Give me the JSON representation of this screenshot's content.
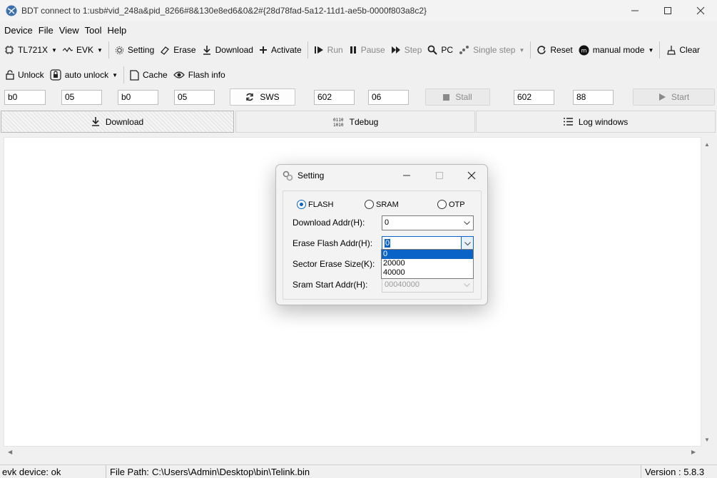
{
  "window": {
    "title": "BDT connect to 1:usb#vid_248a&pid_8266#8&130e8ed6&0&2#{28d78fad-5a12-11d1-ae5b-0000f803a8c2}"
  },
  "menu": [
    "Device",
    "File",
    "View",
    "Tool",
    "Help"
  ],
  "toolbar1": {
    "chip": "TL721X",
    "board": "EVK",
    "setting": "Setting",
    "erase": "Erase",
    "download": "Download",
    "activate": "Activate",
    "run": "Run",
    "pause": "Pause",
    "step": "Step",
    "pc": "PC",
    "single_step": "Single step",
    "reset": "Reset",
    "mode": "manual mode",
    "clear": "Clear"
  },
  "toolbar2": {
    "unlock": "Unlock",
    "auto_unlock": "auto unlock",
    "cache": "Cache",
    "flash_info": "Flash info"
  },
  "registers": {
    "f1": "b0",
    "f2": "05",
    "f3": "b0",
    "f4": "05",
    "sws": "SWS",
    "f5": "602",
    "f6": "06",
    "stall": "Stall",
    "f7": "602",
    "f8": "88",
    "start": "Start"
  },
  "tabs": {
    "download": "Download",
    "tdebug": "Tdebug",
    "log": "Log windows"
  },
  "status": {
    "device": "evk device: ok",
    "file_path_label": "File Path:",
    "file_path": "C:\\Users\\Admin\\Desktop\\bin\\Telink.bin",
    "version": "Version : 5.8.3"
  },
  "dialog": {
    "title": "Setting",
    "mem_options": [
      "FLASH",
      "SRAM",
      "OTP"
    ],
    "selected_mem": "FLASH",
    "download_addr_label": "Download  Addr(H):",
    "download_addr": "0",
    "erase_addr_label": "Erase Flash Addr(H):",
    "erase_addr": "0",
    "sector_label": "Sector Erase Size(K):",
    "sram_label": "Sram Start Addr(H):",
    "sram_addr": "00040000",
    "erase_options": [
      "0",
      "20000",
      "40000"
    ]
  },
  "colors": {
    "accent": "#0a64c8",
    "window_bg": "#f0f0f0"
  }
}
